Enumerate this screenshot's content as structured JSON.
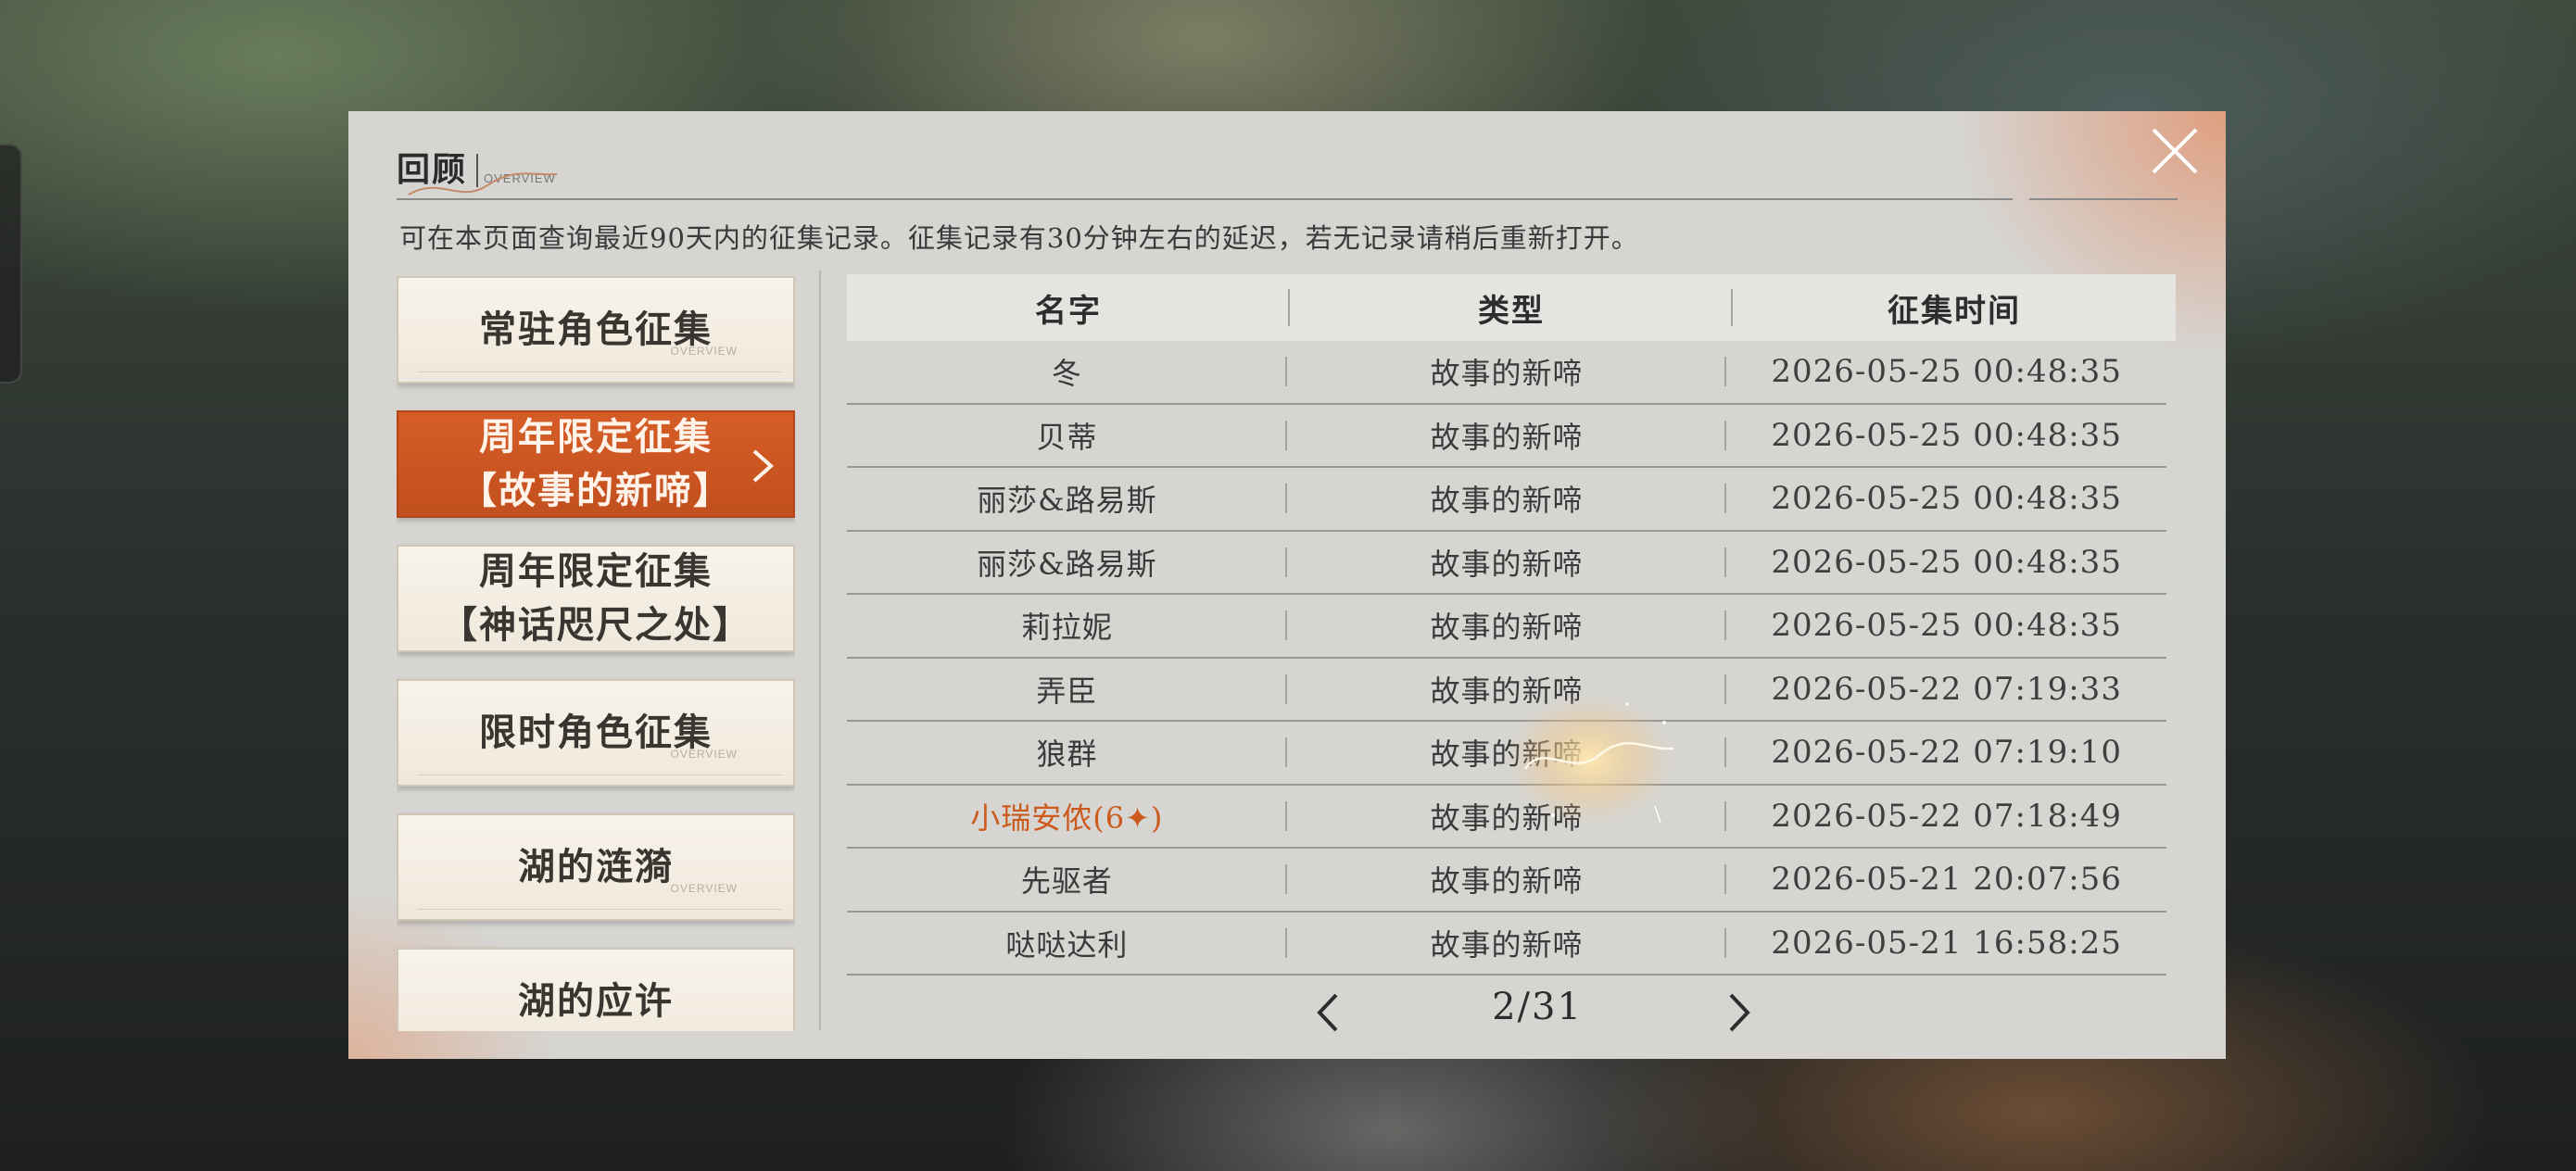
{
  "header": {
    "title": "回顾",
    "subtitle": "OVERVIEW",
    "description": "可在本页面查询最近90天内的征集记录。征集记录有30分钟左右的延迟，若无记录请稍后重新打开。"
  },
  "tabs": [
    {
      "line1": "常驻角色征集",
      "line2": "",
      "active": false
    },
    {
      "line1": "周年限定征集",
      "line2": "【故事的新啼】",
      "active": true
    },
    {
      "line1": "周年限定征集",
      "line2": "【神话咫尺之处】",
      "active": false
    },
    {
      "line1": "限时角色征集",
      "line2": "",
      "active": false
    },
    {
      "line1": "湖的涟漪",
      "line2": "",
      "active": false
    },
    {
      "line1": "湖的应许",
      "line2": "",
      "active": false
    }
  ],
  "tab_footer": "OVERVIEW",
  "table": {
    "headers": {
      "name": "名字",
      "type": "类型",
      "time": "征集时间"
    },
    "rows": [
      {
        "name": "冬",
        "type": "故事的新啼",
        "time": "2026-05-25 00:48:35",
        "highlight": false
      },
      {
        "name": "贝蒂",
        "type": "故事的新啼",
        "time": "2026-05-25 00:48:35",
        "highlight": false
      },
      {
        "name": "丽莎&路易斯",
        "type": "故事的新啼",
        "time": "2026-05-25 00:48:35",
        "highlight": false
      },
      {
        "name": "丽莎&路易斯",
        "type": "故事的新啼",
        "time": "2026-05-25 00:48:35",
        "highlight": false
      },
      {
        "name": "莉拉妮",
        "type": "故事的新啼",
        "time": "2026-05-25 00:48:35",
        "highlight": false
      },
      {
        "name": "弄臣",
        "type": "故事的新啼",
        "time": "2026-05-22 07:19:33",
        "highlight": false
      },
      {
        "name": "狼群",
        "type": "故事的新啼",
        "time": "2026-05-22 07:19:10",
        "highlight": false
      },
      {
        "name": "小瑞安侬(6✦)",
        "type": "故事的新啼",
        "time": "2026-05-22 07:18:49",
        "highlight": true
      },
      {
        "name": "先驱者",
        "type": "故事的新啼",
        "time": "2026-05-21 20:07:56",
        "highlight": false
      },
      {
        "name": "哒哒达利",
        "type": "故事的新啼",
        "time": "2026-05-21 16:58:25",
        "highlight": false
      }
    ]
  },
  "pager": {
    "text": "2/31"
  },
  "colors": {
    "accent": "#c9541f",
    "highlight_text": "#cc5a1c",
    "panel_bg": "#d6d5d2"
  },
  "icons": {
    "close": "close-icon",
    "prev": "chevron-left-icon",
    "next": "chevron-right-icon",
    "tab_arrow": "chevron-right-icon"
  }
}
